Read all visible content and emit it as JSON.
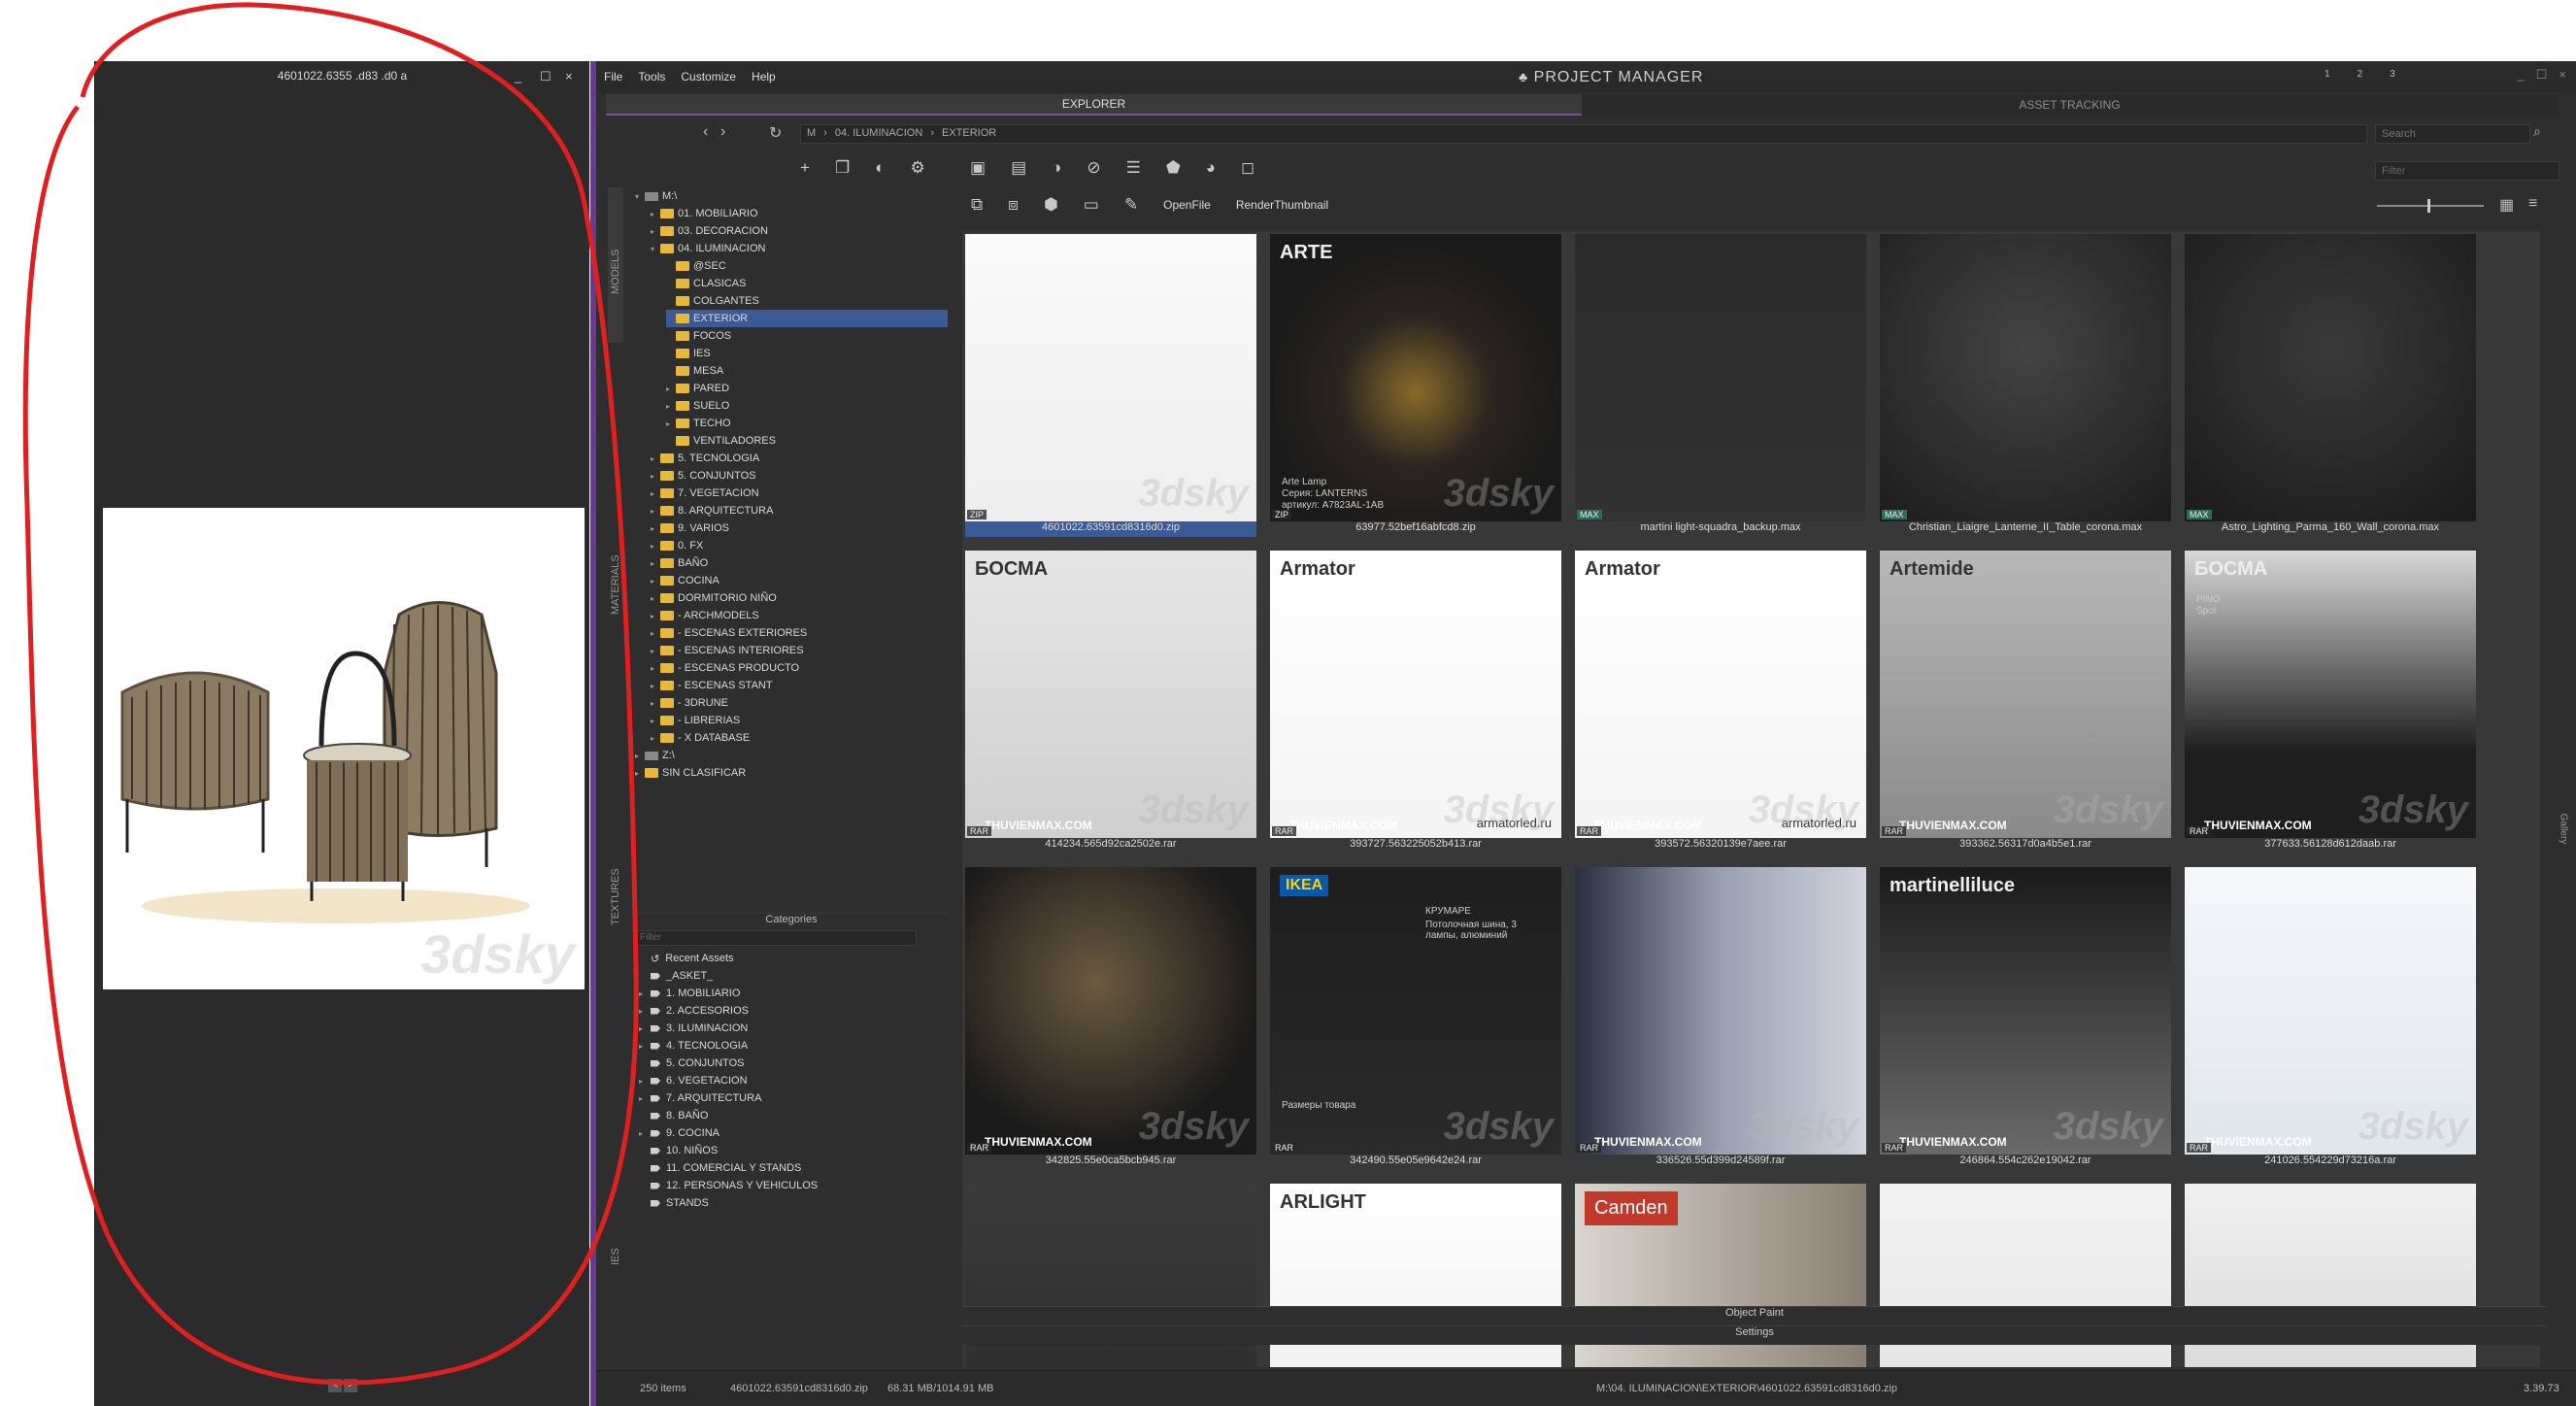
{
  "preview": {
    "title": "4601022.6355 .d83 .d0 a",
    "min": "_",
    "max": "☐",
    "close": "×",
    "nav_prev": "<",
    "nav_next": ">",
    "watermark": "3dsky"
  },
  "menu": [
    "File",
    "Tools",
    "Customize",
    "Help"
  ],
  "app_title": "PROJECT MANAGER",
  "workspaces": [
    "1",
    "2",
    "3"
  ],
  "tabs": {
    "explorer": "EXPLORER",
    "asset_tracking": "ASSET TRACKING"
  },
  "address": {
    "path": [
      "M",
      "04. ILUMINACION",
      "EXTERIOR"
    ],
    "search_placeholder": "Search",
    "filter_placeholder": "Filter"
  },
  "toolbar2": {
    "open_file": "OpenFile",
    "render_thumbnail": "RenderThumbnail"
  },
  "side_tabs": [
    "MODELS",
    "MATERIALS",
    "TEXTURES",
    "IES"
  ],
  "tree": [
    {
      "label": "M:\\",
      "level": 0,
      "type": "drive",
      "expand": "▾"
    },
    {
      "label": "01. MOBILIARIO",
      "level": 1,
      "type": "folder",
      "expand": "▸"
    },
    {
      "label": "03. DECORACION",
      "level": 1,
      "type": "folder",
      "expand": "▸"
    },
    {
      "label": "04. ILUMINACION",
      "level": 1,
      "type": "folder",
      "expand": "▾"
    },
    {
      "label": "@SEC",
      "level": 2,
      "type": "folder",
      "expand": ""
    },
    {
      "label": "CLASICAS",
      "level": 2,
      "type": "folder",
      "expand": ""
    },
    {
      "label": "COLGANTES",
      "level": 2,
      "type": "folder",
      "expand": ""
    },
    {
      "label": "EXTERIOR",
      "level": 2,
      "type": "folder",
      "expand": "",
      "selected": true
    },
    {
      "label": "FOCOS",
      "level": 2,
      "type": "folder",
      "expand": ""
    },
    {
      "label": "IES",
      "level": 2,
      "type": "folder",
      "expand": ""
    },
    {
      "label": "MESA",
      "level": 2,
      "type": "folder",
      "expand": ""
    },
    {
      "label": "PARED",
      "level": 2,
      "type": "folder",
      "expand": "▸"
    },
    {
      "label": "SUELO",
      "level": 2,
      "type": "folder",
      "expand": "▸"
    },
    {
      "label": "TECHO",
      "level": 2,
      "type": "folder",
      "expand": "▸"
    },
    {
      "label": "VENTILADORES",
      "level": 2,
      "type": "folder",
      "expand": ""
    },
    {
      "label": "5. TECNOLOGIA",
      "level": 1,
      "type": "folder",
      "expand": "▸"
    },
    {
      "label": "5. CONJUNTOS",
      "level": 1,
      "type": "folder",
      "expand": "▸"
    },
    {
      "label": "7. VEGETACION",
      "level": 1,
      "type": "folder",
      "expand": "▸"
    },
    {
      "label": "8. ARQUITECTURA",
      "level": 1,
      "type": "folder",
      "expand": "▸"
    },
    {
      "label": "9. VARIOS",
      "level": 1,
      "type": "folder",
      "expand": "▸"
    },
    {
      "label": "0. FX",
      "level": 1,
      "type": "folder",
      "expand": "▸"
    },
    {
      "label": "BAÑO",
      "level": 1,
      "type": "folder",
      "expand": "▸"
    },
    {
      "label": "COCINA",
      "level": 1,
      "type": "folder",
      "expand": "▸"
    },
    {
      "label": "DORMITORIO NIÑO",
      "level": 1,
      "type": "folder",
      "expand": "▸"
    },
    {
      "label": "- ARCHMODELS",
      "level": 1,
      "type": "folder",
      "expand": "▸"
    },
    {
      "label": "- ESCENAS EXTERIORES",
      "level": 1,
      "type": "folder",
      "expand": "▸"
    },
    {
      "label": "- ESCENAS INTERIORES",
      "level": 1,
      "type": "folder",
      "expand": "▸"
    },
    {
      "label": "- ESCENAS PRODUCTO",
      "level": 1,
      "type": "folder",
      "expand": "▸"
    },
    {
      "label": "- ESCENAS STANT",
      "level": 1,
      "type": "folder",
      "expand": "▸"
    },
    {
      "label": "- 3DRUNE",
      "level": 1,
      "type": "folder",
      "expand": "▸"
    },
    {
      "label": "- LIBRERIAS",
      "level": 1,
      "type": "folder",
      "expand": "▸"
    },
    {
      "label": "- X DATABASE",
      "level": 1,
      "type": "folder",
      "expand": "▸"
    },
    {
      "label": "Z:\\",
      "level": 0,
      "type": "drive",
      "expand": "▸"
    },
    {
      "label": "SIN CLASIFICAR",
      "level": 0,
      "type": "folder",
      "expand": "▸"
    }
  ],
  "categories": {
    "header": "Categories",
    "filter_placeholder": "Filter",
    "items": [
      {
        "label": "Recent Assets",
        "expand": "",
        "recent": true
      },
      {
        "label": "_ASKET_",
        "expand": ""
      },
      {
        "label": "1. MOBILIARIO",
        "expand": "▸"
      },
      {
        "label": "2. ACCESORIOS",
        "expand": "▸"
      },
      {
        "label": "3. ILUMINACION",
        "expand": "▸"
      },
      {
        "label": "4. TECNOLOGIA",
        "expand": "▸"
      },
      {
        "label": "5. CONJUNTOS",
        "expand": ""
      },
      {
        "label": "6. VEGETACION",
        "expand": "▸"
      },
      {
        "label": "7. ARQUITECTURA",
        "expand": "▸"
      },
      {
        "label": "8. BAÑO",
        "expand": ""
      },
      {
        "label": "9. COCINA",
        "expand": "▸"
      },
      {
        "label": "10. NIÑOS",
        "expand": ""
      },
      {
        "label": "11. COMERCIAL Y STANDS",
        "expand": ""
      },
      {
        "label": "12. PERSONAS Y VEHICULOS",
        "expand": ""
      },
      {
        "label": "STANDS",
        "expand": ""
      }
    ]
  },
  "assets": [
    {
      "name": "4601022.63591cd8316d0.zip",
      "badge": "ZIP",
      "selected": true
    },
    {
      "name": "63977.52bef16abfcd8.zip",
      "badge": "ZIP",
      "brand": "ARTE",
      "text1": "Arte Lamp",
      "text2": "Серия: LANTERNS",
      "text3": "артикул: A7823AL-1AB"
    },
    {
      "name": "martini light-squadra_backup.max",
      "badge": "MAX"
    },
    {
      "name": "Christian_Liaigre_Lanterne_II_Table_corona.max",
      "badge": "MAX"
    },
    {
      "name": "Astro_Lighting_Parma_160_Wall_corona.max",
      "badge": "MAX"
    },
    {
      "name": "414234.565d92ca2502e.rar",
      "badge": "RAR",
      "brand": "БОСМА",
      "site": "THUVIENMAX.COM"
    },
    {
      "name": "393727.563225052b413.rar",
      "badge": "RAR",
      "brand": "Armator",
      "site": "THUVIENMAX.COM",
      "url": "armatorled.ru"
    },
    {
      "name": "393572.56320139e7aee.rar",
      "badge": "RAR",
      "brand": "Armator",
      "site": "THUVIENMAX.COM",
      "url": "armatorled.ru"
    },
    {
      "name": "393362.56317d0a4b5e1.rar",
      "badge": "RAR",
      "brand": "Artemide",
      "site": "THUVIENMAX.COM"
    },
    {
      "name": "377633.56128d612daab.rar",
      "badge": "RAR",
      "brand": "БОСМА",
      "text1": "PINO",
      "text2": "Spot",
      "site": "THUVIENMAX.COM"
    },
    {
      "name": "342825.55e0ca5bcb945.rar",
      "badge": "RAR",
      "site": "THUVIENMAX.COM"
    },
    {
      "name": "342490.55e05e9642e24.rar",
      "badge": "RAR",
      "brand": "IKEA",
      "text1": "КРУМАРЕ",
      "text2": "Потолочная шина, 3 лампы, алюминий",
      "text3": "Размеры товара"
    },
    {
      "name": "336526.55d399d24589f.rar",
      "badge": "RAR",
      "site": "THUVIENMAX.COM"
    },
    {
      "name": "246864.554c262e19042.rar",
      "badge": "RAR",
      "brand": "martinelliluce",
      "site": "THUVIENMAX.COM"
    },
    {
      "name": "241026.554229d73216a.rar",
      "badge": "RAR",
      "site": "THUVIENMAX.COM"
    },
    {
      "name": "",
      "badge": ""
    },
    {
      "name": "",
      "badge": "",
      "brand": "ARLIGHT"
    },
    {
      "name": "",
      "badge": "",
      "brand": "Camden"
    },
    {
      "name": "",
      "badge": ""
    },
    {
      "name": "",
      "badge": ""
    }
  ],
  "watermark": "3dsky",
  "bottom_panels": {
    "object_paint": "Object Paint",
    "settings": "Settings"
  },
  "right_strip": "Gallery",
  "status": {
    "count": "250 items",
    "file": "4601022.63591cd8316d0.zip",
    "size": "68.31 MB/1014.91 MB",
    "path": "M:\\04. ILUMINACION\\EXTERIOR\\4601022.63591cd8316d0.zip",
    "version": "3.39.73"
  }
}
